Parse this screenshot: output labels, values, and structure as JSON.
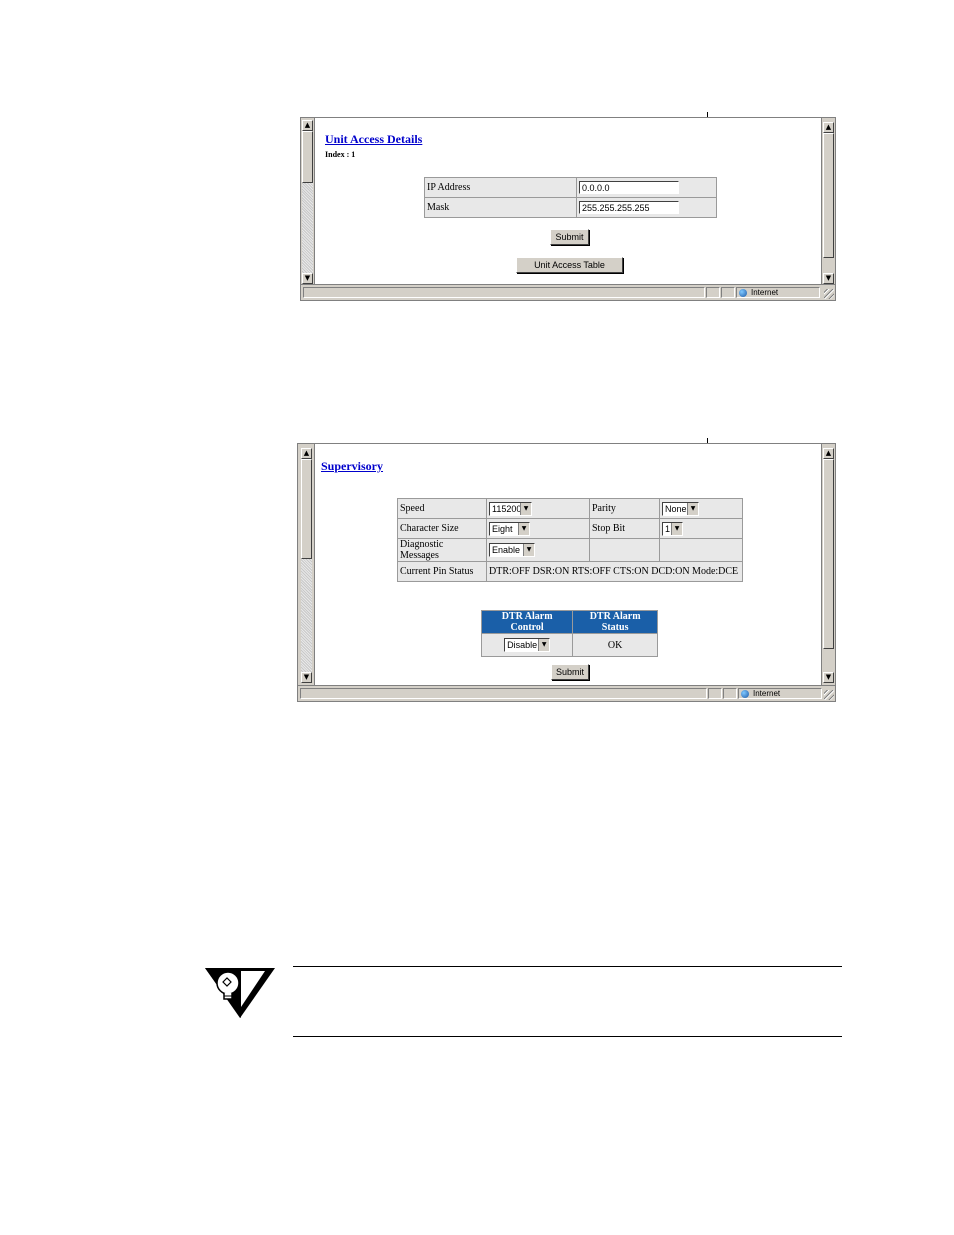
{
  "unit_access": {
    "title": "Unit Access Details",
    "index_label": "Index : 1",
    "fields": [
      {
        "label": "IP Address",
        "value": "0.0.0.0"
      },
      {
        "label": "Mask",
        "value": "255.255.255.255"
      }
    ],
    "submit_label": "Submit",
    "table_button_label": "Unit Access Table",
    "status_zone": "Internet"
  },
  "supervisory": {
    "title": "Supervisory",
    "rows": {
      "speed_label": "Speed",
      "speed_value": "115200",
      "parity_label": "Parity",
      "parity_value": "None",
      "char_size_label": "Character Size",
      "char_size_value": "Eight",
      "stop_bit_label": "Stop Bit",
      "stop_bit_value": "1",
      "diag_label": "Diagnostic Messages",
      "diag_value": "Enable",
      "pin_status_label": "Current Pin Status",
      "pin_status_value": "DTR:OFF DSR:ON RTS:OFF CTS:ON DCD:ON Mode:DCE"
    },
    "alarm": {
      "control_header": "DTR Alarm Control",
      "status_header": "DTR Alarm Status",
      "control_value": "Disable",
      "status_value": "OK"
    },
    "submit_label": "Submit",
    "status_zone": "Internet"
  },
  "icons": {
    "scroll_up": "▲",
    "scroll_down": "▼",
    "dropdown": "▼"
  }
}
